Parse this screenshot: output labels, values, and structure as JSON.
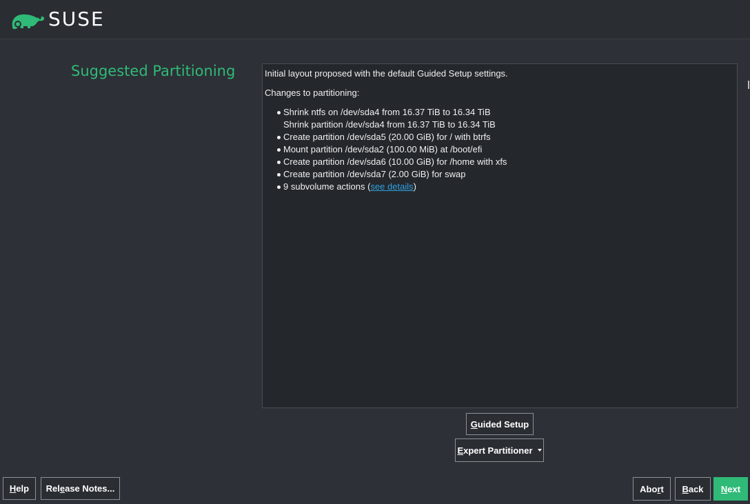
{
  "header": {
    "brand": "SUSE",
    "logo_icon": "suse-chameleon-icon",
    "brand_color": "#30ba78"
  },
  "page": {
    "title": "Suggested Partitioning"
  },
  "summary": {
    "intro": "Initial layout proposed with the default Guided Setup settings.",
    "changes_heading": "Changes to partitioning:",
    "items": [
      {
        "text": "Shrink ntfs on /dev/sda4 from 16.37 TiB to 16.34 TiB",
        "sub": "Shrink partition /dev/sda4 from 16.37 TiB to 16.34 TiB"
      },
      {
        "text": "Create partition /dev/sda5 (20.00 GiB) for / with btrfs"
      },
      {
        "text": "Mount partition /dev/sda2 (100.00 MiB) at /boot/efi"
      },
      {
        "text": "Create partition /dev/sda6 (10.00 GiB) for /home with xfs"
      },
      {
        "text": "Create partition /dev/sda7 (2.00 GiB) for swap"
      }
    ],
    "subvolume": {
      "prefix": "9 subvolume actions (",
      "link": "see details",
      "suffix": ")"
    }
  },
  "actions": {
    "guided_setup": {
      "mnemonic": "G",
      "rest": "uided Setup"
    },
    "expert_partitioner": {
      "mnemonic": "E",
      "rest": "xpert Partitioner"
    }
  },
  "footer": {
    "help": {
      "mnemonic": "H",
      "rest": "elp"
    },
    "release_notes": {
      "before": "Rel",
      "mnemonic": "e",
      "after": "ase Notes..."
    },
    "abort": {
      "before": "Abo",
      "mnemonic": "r",
      "after": "t"
    },
    "back": {
      "mnemonic": "B",
      "rest": "ack"
    },
    "next": {
      "mnemonic": "N",
      "rest": "ext"
    }
  }
}
